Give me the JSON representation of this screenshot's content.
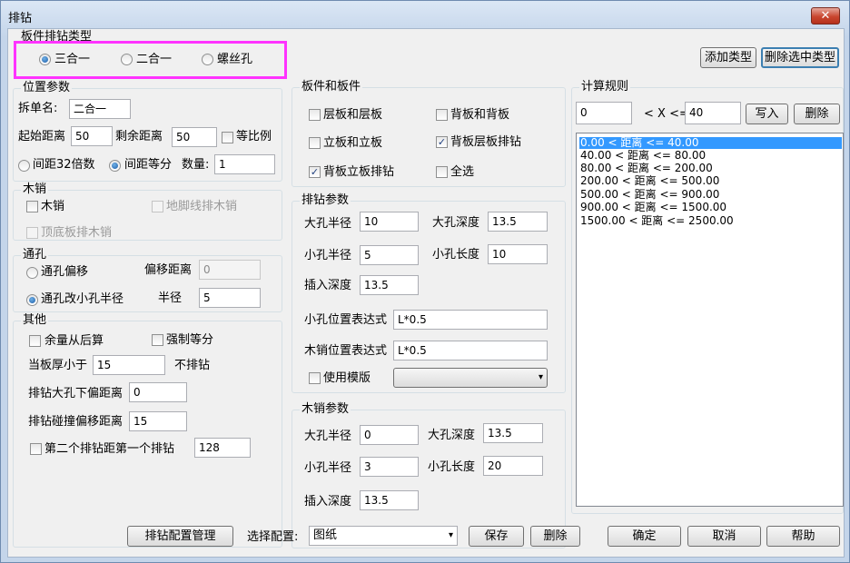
{
  "window": {
    "title": "排钻",
    "close": "✕"
  },
  "board_type": {
    "label": "板件排钻类型",
    "options": [
      "三合一",
      "二合一",
      "螺丝孔"
    ],
    "selected": 0
  },
  "type_buttons": {
    "add": "添加类型",
    "delete_selected": "删除选中类型"
  },
  "position": {
    "label": "位置参数",
    "split_name_label": "拆单名:",
    "split_name_value": "二合一",
    "start_label": "起始距离",
    "start_value": "50",
    "remain_label": "剩余距离",
    "remain_value": "50",
    "proportional_label": "等比例",
    "spacing32_label": "间距32倍数",
    "equal_label": "间距等分",
    "count_label": "数量:",
    "count_value": "1"
  },
  "dowel": {
    "label": "木销",
    "dowel_label": "木销",
    "skirting_label": "地脚线排木销",
    "top_bottom_label": "顶底板排木销"
  },
  "through": {
    "label": "通孔",
    "offset_label": "通孔偏移",
    "offset_dist_label": "偏移距离",
    "offset_dist_value": "0",
    "small_radius_label": "通孔改小孔半径",
    "radius_label": "半径",
    "radius_value": "5"
  },
  "other": {
    "label": "其他",
    "remainder_label": "余量从后算",
    "force_equal_label": "强制等分",
    "thickness_label": "当板厚小于",
    "thickness_value": "15",
    "no_drill_label": "不排钻",
    "big_offset_label": "排钻大孔下偏距离",
    "big_offset_value": "0",
    "collision_label": "排钻碰撞偏移距离",
    "collision_value": "15",
    "second_label": "第二个排钻距第一个排钻",
    "second_value": "128"
  },
  "board_board": {
    "label": "板件和板件",
    "layer_layer": "层板和层板",
    "back_back": "背板和背板",
    "vert_vert": "立板和立板",
    "back_layer": "背板层板排钻",
    "back_vert": "背板立板排钻",
    "select_all": "全选"
  },
  "drill_params": {
    "label": "排钻参数",
    "big_radius_label": "大孔半径",
    "big_radius_value": "10",
    "big_depth_label": "大孔深度",
    "big_depth_value": "13.5",
    "small_radius_label": "小孔半径",
    "small_radius_value": "5",
    "small_length_label": "小孔长度",
    "small_length_value": "10",
    "insert_depth_label": "插入深度",
    "insert_depth_value": "13.5",
    "small_pos_label": "小孔位置表达式",
    "small_pos_value": "L*0.5",
    "dowel_pos_label": "木销位置表达式",
    "dowel_pos_value": "L*0.5",
    "use_template_label": "使用模版",
    "template_value": ""
  },
  "dowel_params": {
    "label": "木销参数",
    "big_radius_label": "大孔半径",
    "big_radius_value": "0",
    "big_depth_label": "大孔深度",
    "big_depth_value": "13.5",
    "small_radius_label": "小孔半径",
    "small_radius_value": "3",
    "small_length_label": "小孔长度",
    "small_length_value": "20",
    "insert_depth_label": "插入深度",
    "insert_depth_value": "13.5"
  },
  "calc_rules": {
    "label": "计算规则",
    "min_value": "0",
    "range_label": "< X <=",
    "max_value": "40",
    "write_label": "写入",
    "delete_label": "删除",
    "rules": [
      "0.00 < 距离 <= 40.00",
      "40.00 < 距离 <= 80.00",
      "80.00 < 距离 <= 200.00",
      "200.00 < 距离 <= 500.00",
      "500.00 < 距离 <= 900.00",
      "900.00 < 距离 <= 1500.00",
      "1500.00 < 距离 <= 2500.00"
    ]
  },
  "bottom": {
    "config_manage": "排钻配置管理",
    "select_config_label": "选择配置:",
    "config_value": "图纸",
    "save": "保存",
    "delete": "删除",
    "ok": "确定",
    "cancel": "取消",
    "help": "帮助"
  },
  "icons": {
    "dropdown": "▾",
    "check": "✓"
  },
  "colors": {
    "highlight": "#ff33ff",
    "selection": "#3399ff"
  }
}
